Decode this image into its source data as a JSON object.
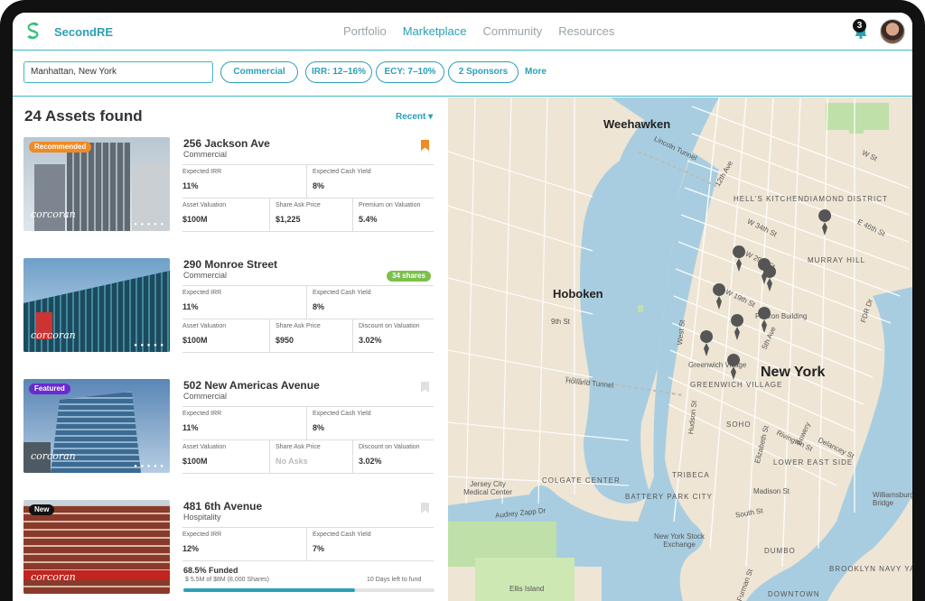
{
  "brand": {
    "name": "SecondRE"
  },
  "nav": {
    "items": [
      "Portfolio",
      "Marketplace",
      "Community",
      "Resources"
    ],
    "active": "Marketplace"
  },
  "notifications": {
    "count": "3"
  },
  "filters": {
    "location": "Manhattan, New York",
    "chips": [
      "Commercial",
      "IRR: 12–16%",
      "ECY: 7–10%",
      "2 Sponsors"
    ],
    "more": "More"
  },
  "results": {
    "count_label": "24 Assets found",
    "sort_label": "Recent"
  },
  "listings": [
    {
      "tag": "Recommended",
      "tag_color": "#f08a24",
      "title": "256 Jackson Ave",
      "type": "Commercial",
      "bookmarked": true,
      "watermark": "corcoran",
      "dots": "● ● ● ● ●",
      "irr_label": "Expected IRR",
      "irr": "11%",
      "ecy_label": "Expected Cash Yield",
      "ecy": "8%",
      "val_label": "Asset Valuation",
      "valuation": "$100M",
      "ask_label": "Share Ask Price",
      "ask": "$1,225",
      "disc_label": "Premium on Valuation",
      "disc": "5.4%"
    },
    {
      "shares_chip": "34 shares",
      "title": "290 Monroe Street",
      "type": "Commercial",
      "watermark": "corcoran",
      "dots": "● ● ● ● ●",
      "irr_label": "Expected IRR",
      "irr": "11%",
      "ecy_label": "Expected Cash Yield",
      "ecy": "8%",
      "val_label": "Asset Valuation",
      "valuation": "$100M",
      "ask_label": "Share Ask Price",
      "ask": "$950",
      "disc_label": "Discount on Valuation",
      "disc": "3.02%"
    },
    {
      "tag": "Featured",
      "tag_color": "#6a2ad1",
      "title": "502 New Americas Avenue",
      "type": "Commercial",
      "bookmarked": false,
      "watermark": "corcoran",
      "dots": "● ● ● ● ●",
      "irr_label": "Expected IRR",
      "irr": "11%",
      "ecy_label": "Expected Cash Yield",
      "ecy": "8%",
      "val_label": "Asset Valuation",
      "valuation": "$100M",
      "ask_label": "Share Ask Price",
      "ask": "No Asks",
      "disc_label": "Discount on Valuation",
      "disc": "3.02%"
    },
    {
      "tag": "New",
      "tag_color": "#111111",
      "title": "481 6th Avenue",
      "type": "Hospitality",
      "bookmarked": false,
      "watermark": "corcoran",
      "dots": "● ● ● ● ●",
      "irr_label": "Expected IRR",
      "irr": "12%",
      "ecy_label": "Expected Cash Yield",
      "ecy": "7%",
      "funded_label": "68.5% Funded",
      "funded_fraction": 0.685,
      "funded_detail": "$ 5.5M of $8M (8,000 Shares)",
      "days_left": "10 Days left to fund"
    }
  ],
  "map": {
    "labels": {
      "weehawken": "Weehawken",
      "hoboken": "Hoboken",
      "newyork": "New York",
      "hells": "HELL'S KITCHEN",
      "diamond": "DIAMOND DISTRICT",
      "murray": "MURRAY HILL",
      "greenwich": "GREENWICH VILLAGE",
      "soho": "SOHO",
      "tribeca": "TRIBECA",
      "les": "LOWER EAST SIDE",
      "battery": "BATTERY PARK CITY",
      "colgate": "COLGATE CENTER",
      "dumbo": "DUMBO",
      "bny": "BROOKLYN NAVY YARD",
      "downtown": "DOWNTOWN",
      "lincoln": "Lincoln Tunnel",
      "holland": "Holland Tunnel",
      "fdr": "FDR Dr",
      "flatiron": "Flatiron Building",
      "wvillage": "Greenwich Village",
      "nyse": "New York Stock Exchange",
      "ellis": "Ellis Island",
      "jcmc": "Jersey City Medical Center",
      "audrey": "Audrey Zapp Dr",
      "williamsburg": "Williamsburg Bridge",
      "southst": "South St",
      "madison": "Madison St",
      "west": "West St",
      "fifth": "5th Ave",
      "w34": "W 34th St",
      "w29": "W 29th St",
      "w19": "W 19th St",
      "e46": "E 46th St",
      "bowery": "Bowery",
      "delancey": "Delancey St",
      "rivington": "Rivington St",
      "hudson": "Hudson St",
      "elizabeth": "Elizabeth St",
      "furman": "Furman St",
      "wst": "W St",
      "twelfth": "12th Ave",
      "ninth": "9th St"
    }
  }
}
